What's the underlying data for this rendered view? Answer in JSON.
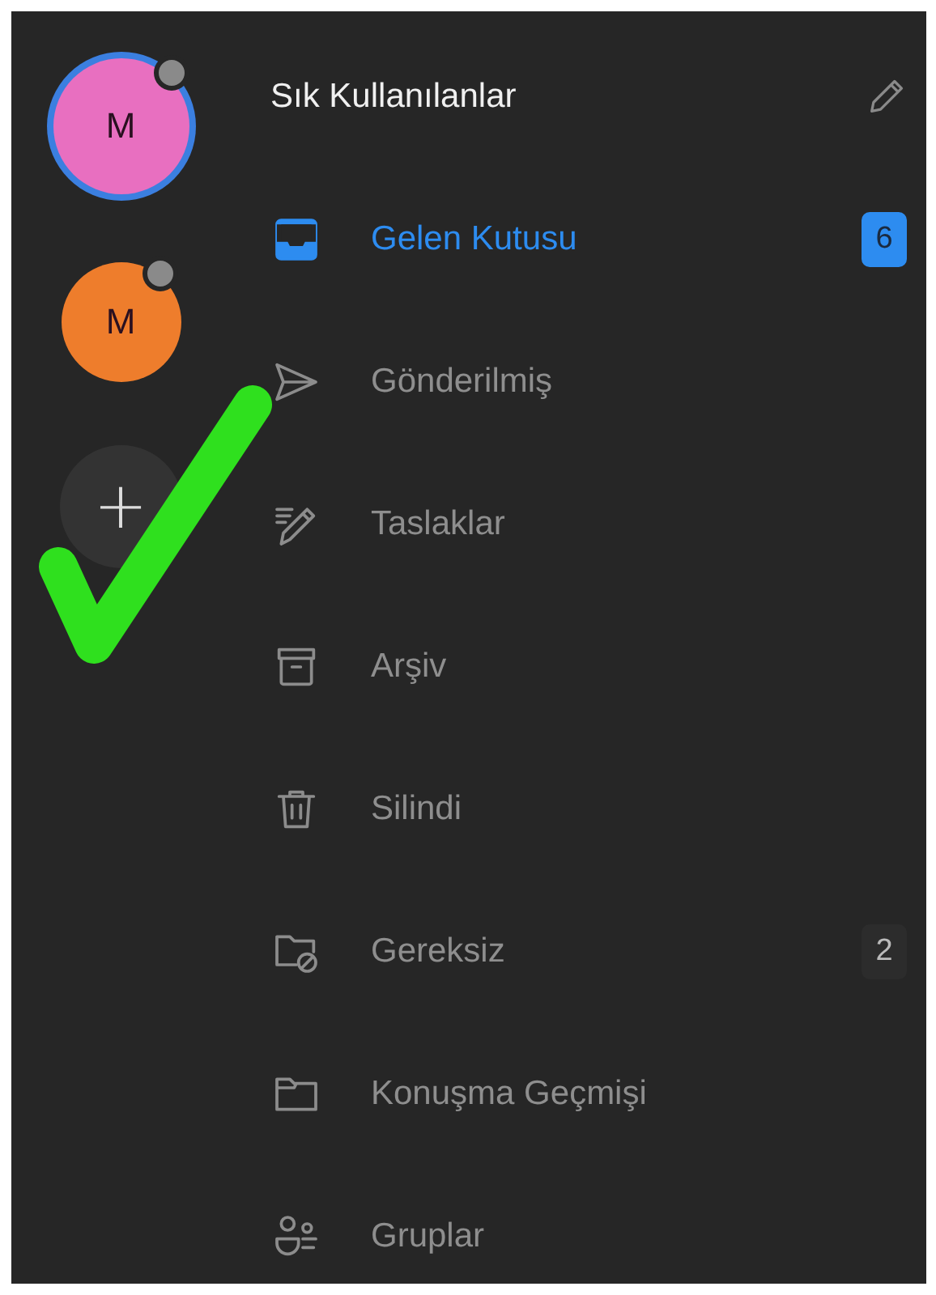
{
  "accounts": [
    {
      "initial": "M",
      "color": "#e86fc0",
      "selected": true
    },
    {
      "initial": "M",
      "color": "#ee7d2c",
      "selected": false
    }
  ],
  "add_account": {
    "label": "+"
  },
  "header": {
    "title": "Sık Kullanılanlar"
  },
  "folders": [
    {
      "kind": "inbox",
      "label": "Gelen Kutusu",
      "selected": true,
      "count": "6"
    },
    {
      "kind": "sent",
      "label": "Gönderilmiş",
      "selected": false
    },
    {
      "kind": "drafts",
      "label": "Taslaklar",
      "selected": false
    },
    {
      "kind": "archive",
      "label": "Arşiv",
      "selected": false
    },
    {
      "kind": "trash",
      "label": "Silindi",
      "selected": false
    },
    {
      "kind": "junk",
      "label": "Gereksiz",
      "selected": false,
      "count": "2"
    },
    {
      "kind": "folder",
      "label": "Konuşma Geçmişi",
      "selected": false
    },
    {
      "kind": "groups",
      "label": "Gruplar",
      "selected": false
    }
  ]
}
